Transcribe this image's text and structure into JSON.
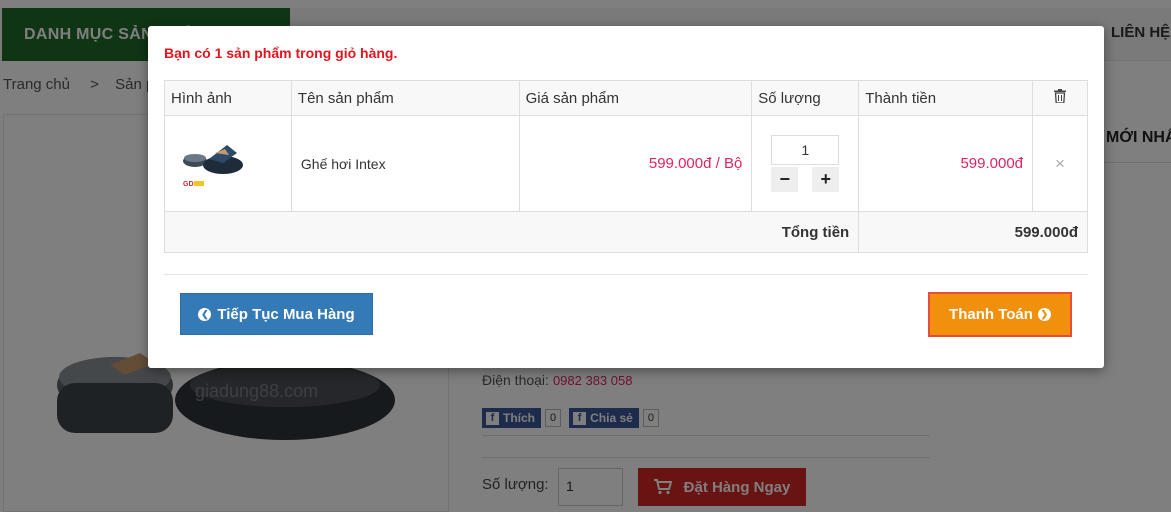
{
  "header": {
    "category_label": "DANH MỤC SẢN PHẨM",
    "nav_last": "LIÊN HỆ"
  },
  "breadcrumb": {
    "home": "Trang chủ",
    "separator": ">",
    "current": "Sản phẩm"
  },
  "sidebar": {
    "newest_heading": "MỚI NHẤT"
  },
  "product": {
    "watermark": "giadung88.com",
    "phone_label": "Điện thoại:",
    "phone_value": "0982 383 058",
    "like_label": "Thích",
    "like_count": "0",
    "share_label": "Chia sẻ",
    "share_count": "0",
    "quantity_label": "Số lượng:",
    "quantity_value": "1",
    "order_button": "Đặt Hàng Ngay"
  },
  "modal": {
    "title": "Bạn có 1 sản phẩm trong giỏ hàng.",
    "columns": {
      "image": "Hình ảnh",
      "name": "Tên sản phẩm",
      "price": "Giá sản phẩm",
      "quantity": "Số lượng",
      "total": "Thành tiền",
      "remove_icon": "trash-icon"
    },
    "items": [
      {
        "image_icon": "inflatable-chair-icon",
        "name": "Ghế hơi Intex",
        "price": "599.000đ / Bộ",
        "quantity": "1",
        "minus": "−",
        "plus": "+",
        "line_total": "599.000đ",
        "remove": "×"
      }
    ],
    "total_label": "Tổng tiền",
    "total_value": "599.000đ",
    "continue_button": "Tiếp Tục Mua Hàng",
    "checkout_button": "Thanh Toán"
  },
  "colors": {
    "accent_red": "#e2151f",
    "price_pink": "#e0245e",
    "continue_blue": "#337ab7",
    "checkout_orange": "#f0900d",
    "category_green": "#1f6b2b"
  }
}
